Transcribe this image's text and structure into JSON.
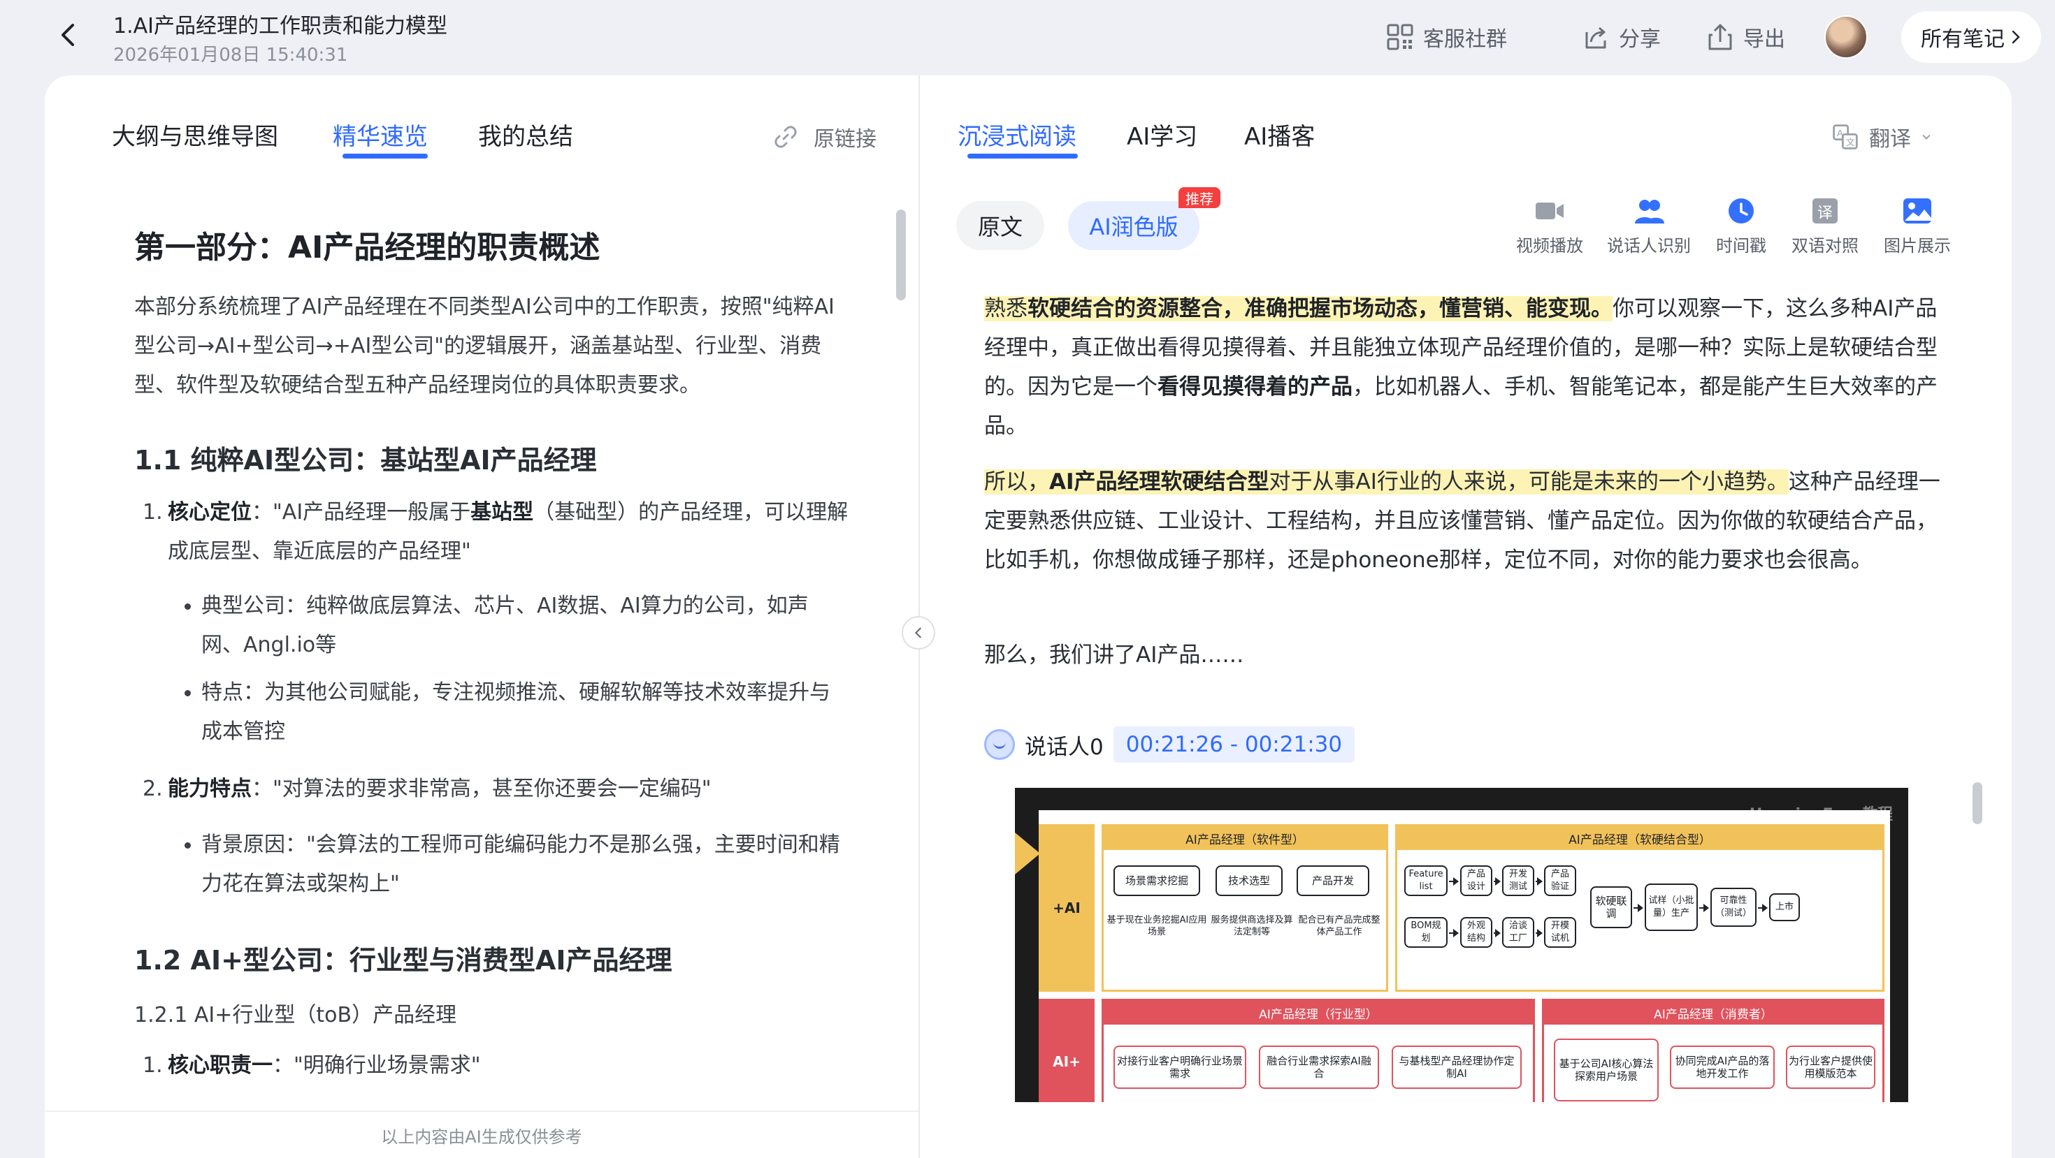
{
  "header": {
    "title": "1.AI产品经理的工作职责和能力模型",
    "datetime": "2026年01月08日 15:40:31",
    "actions": [
      {
        "label": "客服社群",
        "icon": "qr-code-icon"
      },
      {
        "label": "分享",
        "icon": "share-icon"
      },
      {
        "label": "导出",
        "icon": "export-icon"
      }
    ],
    "all_notes": "所有笔记"
  },
  "left": {
    "tabs": [
      "大纲与思维导图",
      "精华速览",
      "我的总结"
    ],
    "active_tab": "精华速览",
    "original_link": "原链接",
    "heading": "第一部分：AI产品经理的职责概述",
    "intro": "本部分系统梳理了AI产品经理在不同类型AI公司中的工作职责，按照\"纯粹AI型公司→AI+型公司→+AI型公司\"的逻辑展开，涵盖基站型、行业型、消费型、软件型及软硬结合型五种产品经理岗位的具体职责要求。",
    "sec1_title": "1.1 纯粹AI型公司：基站型AI产品经理",
    "item1_label": "核心定位",
    "item1_text_a": "：\"AI产品经理一般属于",
    "item1_bold": "基站型",
    "item1_text_b": "（基础型）的产品经理，可以理解成底层型、靠近底层的产品经理\"",
    "bullet1": "典型公司：纯粹做底层算法、芯片、AI数据、AI算力的公司，如声网、Angl.io等",
    "bullet2": "特点：为其他公司赋能，专注视频推流、硬解软解等技术效率提升与成本管控",
    "item2_label": "能力特点",
    "item2_text": "：\"对算法的要求非常高，甚至你还要会一定编码\"",
    "bullet3": "背景原因：\"会算法的工程师可能编码能力不是那么强，主要时间和精力花在算法或架构上\"",
    "sec2_title": "1.2 AI+型公司：行业型与消费型AI产品经理",
    "sub_title": "1.2.1 AI+行业型（toB）产品经理",
    "item3_label": "核心职责一",
    "item3_text": "：\"明确行业场景需求\"",
    "footer": "以上内容由AI生成仅供参考"
  },
  "right": {
    "tabs": [
      "沉浸式阅读",
      "AI学习",
      "AI播客"
    ],
    "active_tab": "沉浸式阅读",
    "translate": "翻译",
    "pill_original": "原文",
    "pill_ai": "AI润色版",
    "badge": "推荐",
    "tools": [
      {
        "label": "视频播放",
        "icon": "video-icon"
      },
      {
        "label": "说话人识别",
        "icon": "speaker-id-icon"
      },
      {
        "label": "时间戳",
        "icon": "clock-icon"
      },
      {
        "label": "双语对照",
        "icon": "bilingual-icon"
      },
      {
        "label": "图片展示",
        "icon": "image-icon"
      }
    ],
    "p1_hl_a": "熟悉",
    "p1_hl_bold": "软硬结合的资源整合，准确把握市场动态，懂营销、能变现。",
    "p1_rest_a": "你可以观察一下，这么多种AI产品经理中，真正做出看得见摸得着、并且能独立体现产品经理价值的，是哪一种？实际上是软硬结合型的。因为它是一个",
    "p1_bold": "看得见摸得着的产品",
    "p1_rest_b": "，比如机器人、手机、智能笔记本，都是能产生巨大效率的产品。",
    "p2_hl_a": "所以，",
    "p2_hl_bold": "AI产品经理软硬结合型",
    "p2_hl_b": "对于从事AI行业的人来说，可能是未来的一个小趋势。",
    "p2_rest": "这种产品经理一定要熟悉供应链、工业设计、工程结构，并且应该懂营销、懂产品定位。因为你做的软硬结合产品，比如手机，你想做成锤子那样，还是phoneone那样，定位不同，对你的能力要求也会很高。",
    "p3": "那么，我们讲了AI产品……",
    "speaker": "说话人0",
    "timestamp": "00:21:26 - 00:21:30"
  },
  "slide": {
    "watermark": "HuggingFace教程",
    "label_plus_ai": "+AI",
    "label_ai_plus": "AI+",
    "box_software": "AI产品经理（软件型）",
    "box_hardware": "AI产品经理（软硬结合型）",
    "box_industry": "AI产品经理（行业型）",
    "box_consumer": "AI产品经理（消费者）",
    "sw_nodes": [
      "场景需求挖掘",
      "技术选型",
      "产品开发"
    ],
    "sw_caps": [
      "基于现在业务挖掘AI应用场景",
      "服务提供商选择及算法定制等",
      "配合已有产品完成整体产品工作"
    ],
    "hw_top": [
      "Feature list",
      "产品设计",
      "开发测试",
      "产品验证"
    ],
    "hw_bottom": [
      "BOM规划",
      "外观结构",
      "洽谈工厂",
      "开模试机"
    ],
    "hw_mid": [
      "软硬联调",
      "试样（小批量）生产",
      "可靠性（测试）",
      "上市"
    ],
    "ind_nodes": [
      "对接行业客户明确行业场景需求",
      "融合行业需求探索AI融合",
      "与基栈型产品经理协作定制AI"
    ],
    "con_nodes": [
      "基于公司AI核心算法探索用户场景",
      "协同完成AI产品的落地开发工作",
      "为行业客户提供使用模版范本"
    ]
  }
}
